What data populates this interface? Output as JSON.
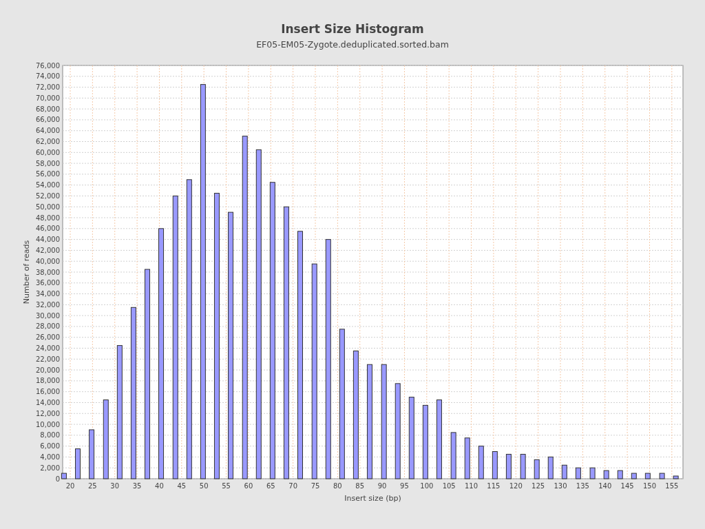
{
  "chart": {
    "title": "Insert Size Histogram",
    "subtitle": "EF05-EM05-Zygote.deduplicated.sorted.bam",
    "chart_data": {
      "type": "bar",
      "xlabel": "Insert size (bp)",
      "ylabel": "Number of reads",
      "xlim": [
        18.3,
        157.5
      ],
      "ylim": [
        0,
        76000
      ],
      "x": [
        18.6,
        21.7,
        24.8,
        28.0,
        31.1,
        34.2,
        37.3,
        40.4,
        43.6,
        46.7,
        49.8,
        52.9,
        56.0,
        59.2,
        62.3,
        65.4,
        68.5,
        71.6,
        74.8,
        77.9,
        81.0,
        84.1,
        87.2,
        90.4,
        93.5,
        96.6,
        99.7,
        102.8,
        106.0,
        109.1,
        112.2,
        115.3,
        118.4,
        121.6,
        124.7,
        127.8,
        130.9,
        134.0,
        137.2,
        140.3,
        143.4,
        146.5,
        149.6,
        152.8,
        155.9
      ],
      "grid": true,
      "values": [
        1000,
        5500,
        9000,
        14500,
        24500,
        31500,
        38500,
        46000,
        52000,
        55000,
        72500,
        52500,
        49000,
        63000,
        60500,
        54500,
        50000,
        45500,
        39500,
        44000,
        27500,
        23500,
        21000,
        21000,
        17500,
        15000,
        13500,
        14500,
        8500,
        7500,
        6000,
        5000,
        4500,
        4500,
        3500,
        4000,
        2500,
        2000,
        2000,
        1500,
        1500,
        1000,
        1000,
        1000,
        500
      ],
      "xticks": [
        20,
        25,
        30,
        35,
        40,
        45,
        50,
        55,
        60,
        65,
        70,
        75,
        80,
        85,
        90,
        95,
        100,
        105,
        110,
        115,
        120,
        125,
        130,
        135,
        140,
        145,
        150,
        155
      ],
      "yticks": [
        {
          "value": 0,
          "label": "0"
        },
        {
          "value": 2000,
          "label": "2,000"
        },
        {
          "value": 4000,
          "label": "4,000"
        },
        {
          "value": 6000,
          "label": "6,000"
        },
        {
          "value": 8000,
          "label": "8,000"
        },
        {
          "value": 10000,
          "label": "10,000"
        },
        {
          "value": 12000,
          "label": "12,000"
        },
        {
          "value": 14000,
          "label": "14,000"
        },
        {
          "value": 16000,
          "label": "16,000"
        },
        {
          "value": 18000,
          "label": "18,000"
        },
        {
          "value": 20000,
          "label": "20,000"
        },
        {
          "value": 22000,
          "label": "22,000"
        },
        {
          "value": 24000,
          "label": "24,000"
        },
        {
          "value": 26000,
          "label": "26,000"
        },
        {
          "value": 28000,
          "label": "28,000"
        },
        {
          "value": 30000,
          "label": "30,000"
        },
        {
          "value": 32000,
          "label": "32,000"
        },
        {
          "value": 34000,
          "label": "34,000"
        },
        {
          "value": 36000,
          "label": "36,000"
        },
        {
          "value": 38000,
          "label": "38,000"
        },
        {
          "value": 40000,
          "label": "40,000"
        },
        {
          "value": 42000,
          "label": "42,000"
        },
        {
          "value": 44000,
          "label": "44,000"
        },
        {
          "value": 46000,
          "label": "46,000"
        },
        {
          "value": 48000,
          "label": "48,000"
        },
        {
          "value": 50000,
          "label": "50,000"
        },
        {
          "value": 52000,
          "label": "52,000"
        },
        {
          "value": 54000,
          "label": "54,000"
        },
        {
          "value": 56000,
          "label": "56,000"
        },
        {
          "value": 58000,
          "label": "58,000"
        },
        {
          "value": 60000,
          "label": "60,000"
        },
        {
          "value": 62000,
          "label": "62,000"
        },
        {
          "value": 64000,
          "label": "64,000"
        },
        {
          "value": 66000,
          "label": "66,000"
        },
        {
          "value": 68000,
          "label": "68,000"
        },
        {
          "value": 70000,
          "label": "70,000"
        },
        {
          "value": 72000,
          "label": "72,000"
        },
        {
          "value": 74000,
          "label": "74,000"
        },
        {
          "value": 76000,
          "label": "76,000"
        }
      ]
    }
  }
}
